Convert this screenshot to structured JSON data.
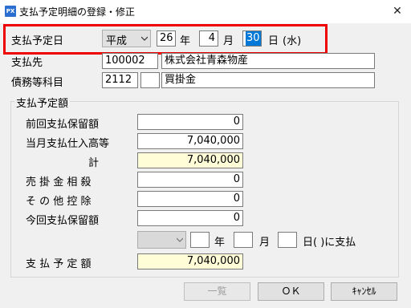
{
  "window": {
    "icon_label": "PX",
    "title": "支払予定明細の登録・修正",
    "close_label": "✕"
  },
  "date_row": {
    "label": "支払予定日",
    "era": "平成",
    "year": "26",
    "year_unit": "年",
    "month": "4",
    "month_unit": "月",
    "day": "30",
    "day_unit": "日",
    "weekday": "(水)"
  },
  "payee": {
    "label": "支払先",
    "code": "100002",
    "name": "株式会社青森物産"
  },
  "account": {
    "label": "債務等科目",
    "code": "2112",
    "sub": "",
    "name": "買掛金"
  },
  "group": {
    "title": "支払予定額",
    "rows": [
      {
        "label": "前回支払保留額",
        "value": "0"
      },
      {
        "label": "当月支払仕入高等",
        "value": "7,040,000"
      },
      {
        "label": "計",
        "value": "7,040,000"
      },
      {
        "label": "売 掛 金 相 殺",
        "value": "0"
      },
      {
        "label": "そ の 他 控 除",
        "value": "0"
      },
      {
        "label": "今回支払保留額",
        "value": "0"
      }
    ],
    "deferral": {
      "era": "",
      "year": "",
      "year_unit": "年",
      "month": "",
      "month_unit": "月",
      "day": "",
      "day_suffix": "日(  )に支払"
    },
    "total": {
      "label": "支 払 予 定 額",
      "value": "7,040,000"
    }
  },
  "buttons": {
    "list": "一覧",
    "ok": "ＯＫ",
    "cancel": "ｷｬﾝｾﾙ"
  }
}
